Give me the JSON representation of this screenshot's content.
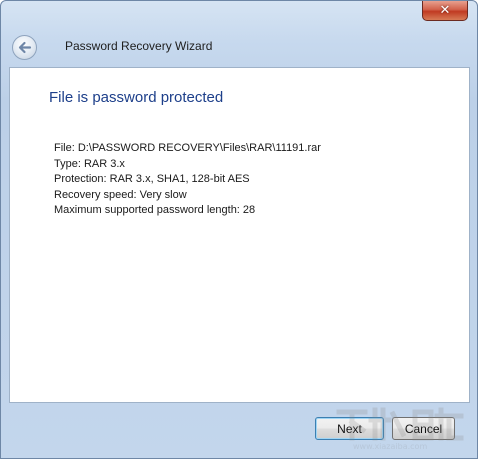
{
  "window": {
    "title": "Password Recovery Wizard",
    "close_icon": "close-icon",
    "back_icon": "back-arrow-icon"
  },
  "page": {
    "heading": "File is password protected",
    "details": {
      "file": "File: D:\\PASSWORD RECOVERY\\Files\\RAR\\11191.rar",
      "type": "Type: RAR 3.x",
      "protection": "Protection: RAR 3.x, SHA1, 128-bit AES",
      "speed": "Recovery speed: Very slow",
      "max_length": "Maximum supported password length: 28"
    }
  },
  "buttons": {
    "next_label": "Next",
    "cancel_label": "Cancel"
  },
  "watermark": {
    "url": "www.xiazaiba.com"
  },
  "colors": {
    "heading": "#1d3f8a",
    "frame": "#c3d6ec",
    "close_button": "#c03a22"
  }
}
